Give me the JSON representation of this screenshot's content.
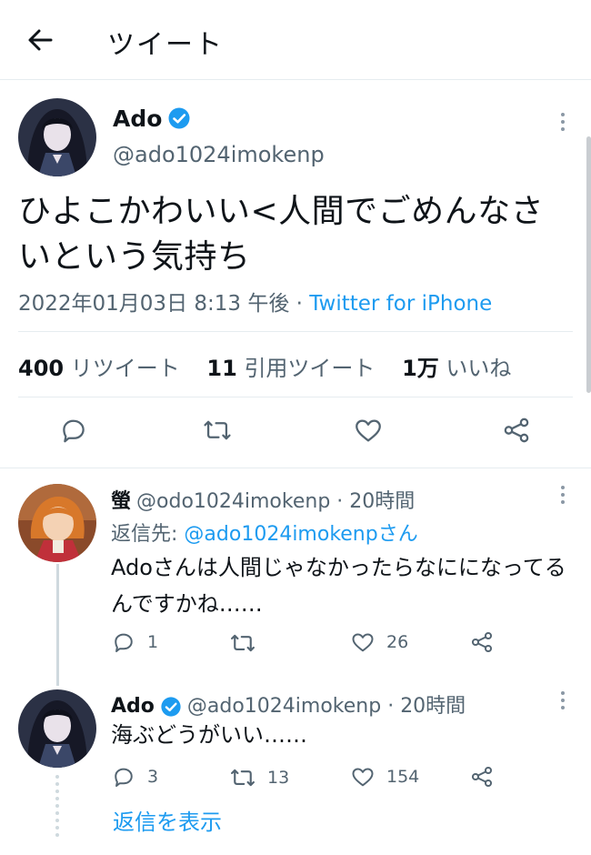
{
  "header": {
    "title": "ツイート",
    "back_icon": "arrow-left-icon"
  },
  "main_tweet": {
    "name": "Ado",
    "handle": "@ado1024imokenp",
    "verified": true,
    "text": "ひよこかわいい<人間でごめんなさいという気持ち",
    "timestamp": "2022年01月03日 8:13 午後",
    "separator": "·",
    "source": "Twitter for iPhone",
    "stats": {
      "retweets_count": "400",
      "retweets_label": "リツイート",
      "quotes_count": "11",
      "quotes_label": "引用ツイート",
      "likes_count": "1万",
      "likes_label": "いいね"
    }
  },
  "replies": [
    {
      "name": "螢",
      "handle": "@odo1024imokenp",
      "separator": "·",
      "time": "20時間",
      "reply_to_label": "返信先:",
      "reply_to_handle": "@ado1024imokenpさん",
      "text": "Adoさんは人間じゃなかったらなにになってるんですかね……",
      "replies_count": "1",
      "retweets_count": "",
      "likes_count": "26"
    },
    {
      "name": "Ado",
      "verified": true,
      "handle": "@ado1024imokenp",
      "separator": "·",
      "time": "20時間",
      "text": "海ぶどうがいい……",
      "replies_count": "3",
      "retweets_count": "13",
      "likes_count": "154"
    }
  ],
  "show_replies_label": "返信を表示",
  "colors": {
    "accent": "#1d9bf0",
    "secondary_text": "#536471",
    "border": "#e6ecf0"
  }
}
